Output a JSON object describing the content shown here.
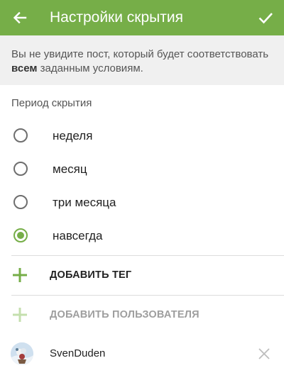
{
  "header": {
    "title": "Настройки скрытия",
    "back_icon": "arrow-left-icon",
    "confirm_icon": "check-icon",
    "bg_color": "#76ae48"
  },
  "info": {
    "text_before": "Вы не увидите пост, который будет соответствовать ",
    "text_bold": "всем",
    "text_after": " заданным условиям."
  },
  "period": {
    "label": "Период скрытия",
    "selected": "навсегда",
    "options": [
      {
        "label": "неделя",
        "checked": false
      },
      {
        "label": "месяц",
        "checked": false
      },
      {
        "label": "три месяца",
        "checked": false
      },
      {
        "label": "навсегда",
        "checked": true
      }
    ]
  },
  "actions": {
    "add_tag": "ДОБАВИТЬ ТЕГ",
    "add_user": "ДОБАВИТЬ ПОЛЬЗОВАТЕЛЯ"
  },
  "users": [
    {
      "name": "SvenDuden",
      "remove_icon": "close-icon"
    }
  ],
  "colors": {
    "accent": "#76ae48",
    "disabled": "#c4dfae"
  }
}
